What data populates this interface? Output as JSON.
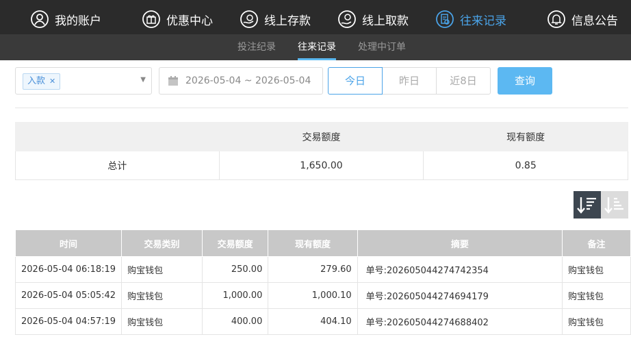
{
  "nav": {
    "items": [
      {
        "label": "我的账户",
        "icon": "user-icon"
      },
      {
        "label": "优惠中心",
        "icon": "gift-icon"
      },
      {
        "label": "线上存款",
        "icon": "deposit-icon"
      },
      {
        "label": "线上取款",
        "icon": "withdraw-icon"
      },
      {
        "label": "往来记录",
        "icon": "record-icon",
        "active": true
      },
      {
        "label": "信息公告",
        "icon": "bell-icon"
      }
    ],
    "active_color": "#4aa3e8"
  },
  "subnav": {
    "items": [
      {
        "label": "投注纪录"
      },
      {
        "label": "往来记录",
        "active": true
      },
      {
        "label": "处理中订单"
      }
    ]
  },
  "filters": {
    "type_tag": "入款",
    "date_range": "2026-05-04 ~ 2026-05-04",
    "quick": [
      "今日",
      "昨日",
      "近8日"
    ],
    "query_label": "查询"
  },
  "summary": {
    "headers": [
      "",
      "交易额度",
      "现有额度"
    ],
    "row": [
      "总计",
      "1,650.00",
      "0.85"
    ]
  },
  "records": {
    "headers": [
      "时间",
      "交易类别",
      "交易额度",
      "现有额度",
      "摘要",
      "备注"
    ],
    "rows": [
      [
        "2026-05-04 06:18:19",
        "购宝钱包",
        "250.00",
        "279.60",
        "单号:202605044274742354",
        "购宝钱包"
      ],
      [
        "2026-05-04 05:05:42",
        "购宝钱包",
        "1,000.00",
        "1,000.10",
        "单号:202605044274694179",
        "购宝钱包"
      ],
      [
        "2026-05-04 04:57:19",
        "购宝钱包",
        "400.00",
        "404.10",
        "单号:202605044274688402",
        "购宝钱包"
      ]
    ]
  }
}
